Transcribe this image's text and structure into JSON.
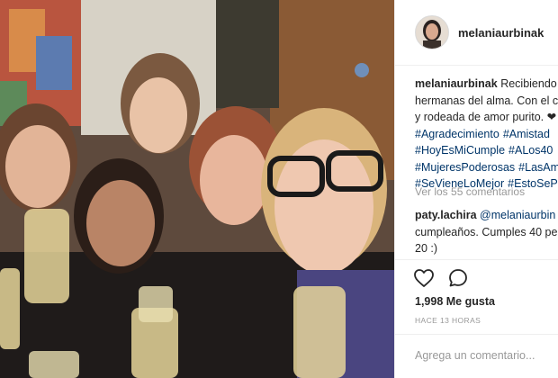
{
  "post": {
    "username": "melaniaurbinak",
    "caption_lines": [
      {
        "user": "melaniaurbinak",
        "text": "Recibiendo"
      },
      {
        "text": "hermanas del alma. Con el c"
      },
      {
        "text": "y rodeada de amor purito. ❤"
      }
    ],
    "hashtag_lines": [
      [
        "#Agradecimiento",
        "#Amistad"
      ],
      [
        "#HoyEsMiCumple",
        "#ALos40"
      ],
      [
        "#MujeresPoderosas",
        "#LasAm"
      ],
      [
        "#SeVieneLoMejor",
        "#EstoSePe"
      ]
    ],
    "view_comments": "Ver los 55 comentarios",
    "comment": {
      "user": "paty.lachira",
      "mention": "@melaniaurbin",
      "lines": [
        "cumpleaños. Cumples 40 pe",
        "20 :)"
      ]
    },
    "likes": "1,998 Me gusta",
    "time": "HACE 13 HORAS",
    "add_comment_placeholder": "Agrega un comentario..."
  },
  "icons": {
    "like": "heart-icon",
    "comment": "comment-bubble-icon"
  },
  "colors": {
    "link": "#003569",
    "muted": "#999999",
    "text": "#262626",
    "border": "#efefef"
  }
}
